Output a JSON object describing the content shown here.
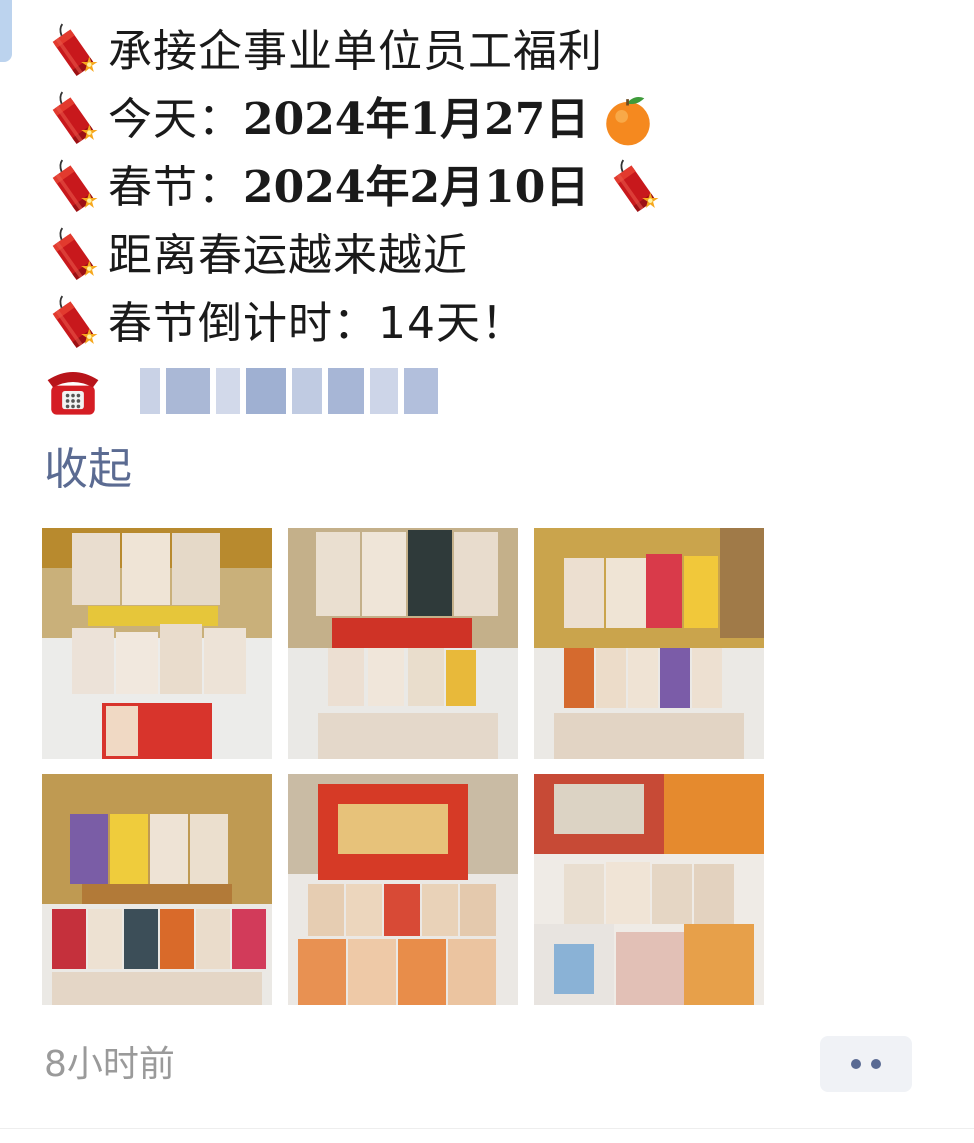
{
  "post": {
    "lines": [
      {
        "prefix": "承接企事业单位员工福利",
        "value": ""
      },
      {
        "prefix": "今天：",
        "value": "2024年1月27日"
      },
      {
        "prefix": "春节：",
        "value": "2024年2月10日"
      },
      {
        "prefix": "距离春运越来越近",
        "value": ""
      },
      {
        "prefix": "春节倒计时：14天！",
        "value": ""
      }
    ],
    "icons": {
      "bullet": "firecracker-icon",
      "today_suffix": "tangerine-icon",
      "spring_suffix": "firecracker-icon",
      "contact": "telephone-icon"
    },
    "collapse_label": "收起"
  },
  "photos": [
    "snack-bags-photo-1",
    "snack-bags-photo-2",
    "snack-bags-photo-3",
    "snack-bags-photo-4",
    "gift-box-photo-5",
    "gift-box-photo-6"
  ],
  "footer": {
    "timestamp": "8小时前",
    "more_icon": "more-dots-icon"
  },
  "colors": {
    "link": "#5b6b92",
    "timestamp": "#9a9a9a",
    "firecracker": "#c8181c"
  }
}
